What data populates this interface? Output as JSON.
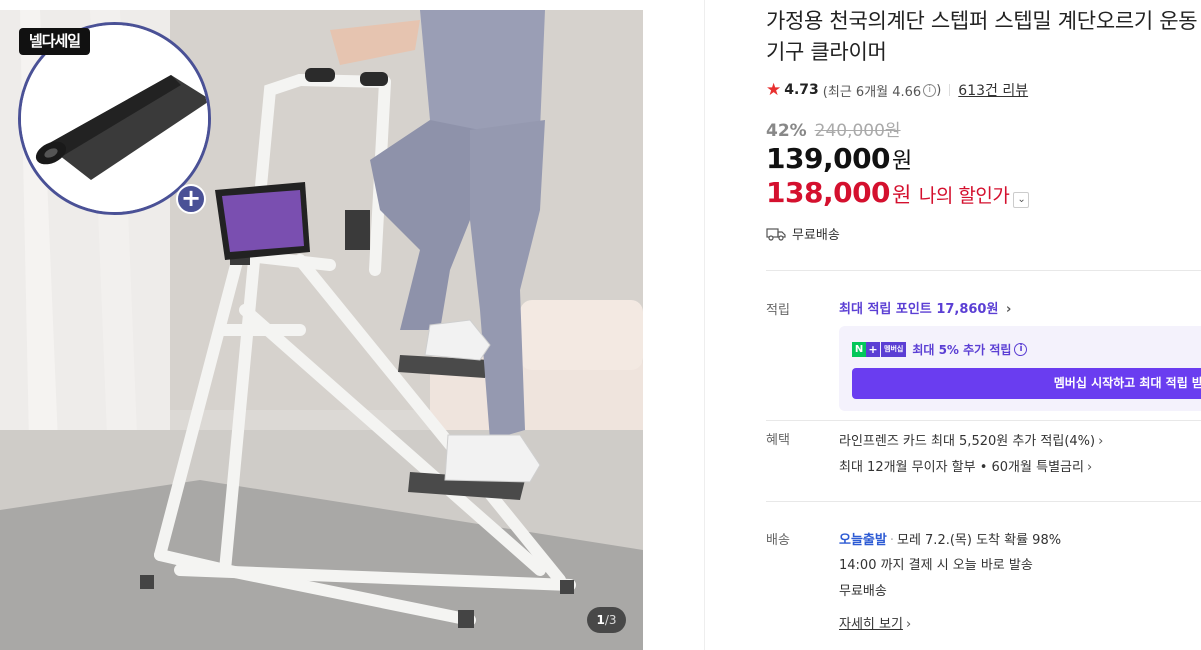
{
  "gallery": {
    "sale_badge": "넬다세일",
    "counter_current": "1",
    "counter_total": "/3"
  },
  "product": {
    "title": "가정용 천국의계단 스텝퍼 스텝밀 계단오르기 운동기구 클라이머",
    "rating": {
      "score": "4.73",
      "recent": "(최근 6개월 4.66",
      "recent_close": ")",
      "review_count_link": "613건 리뷰"
    },
    "discount_percent": "42%",
    "original_price": "240,000원",
    "price": "139,000",
    "price_unit": "원",
    "sale_price": "138,000",
    "sale_unit": "원",
    "my_discount_label": "나의 할인가",
    "shipping": "무료배송"
  },
  "points": {
    "label": "적립",
    "max_point_text": "최대 적립 포인트",
    "max_point_amount": "17,860원",
    "member_badge_n": "N",
    "member_badge_plus": "+",
    "member_badge_text": "멤버십",
    "member_extra": "최대 5% 추가 적립",
    "member_button": "멤버십 시작하고 최대 적립 받기"
  },
  "benefits": {
    "label": "혜택",
    "card": "라인프렌즈 카드 최대 5,520원 추가 적립(4%)",
    "installment": "최대 12개월 무이자 할부 • 60개월 특별금리"
  },
  "delivery": {
    "label": "배송",
    "badge": "오늘출발",
    "arrival": "모레 7.2.(목) 도착 확률 98%",
    "cutoff": "14:00 까지 결제 시 오늘 바로 발송",
    "fee": "무료배송",
    "detail_link": "자세히 보기"
  },
  "colors": {
    "accent_purple": "#5b3fd4",
    "sale_red": "#d4102e",
    "star_red": "#e8302f",
    "delivery_blue": "#2d5bd4"
  }
}
